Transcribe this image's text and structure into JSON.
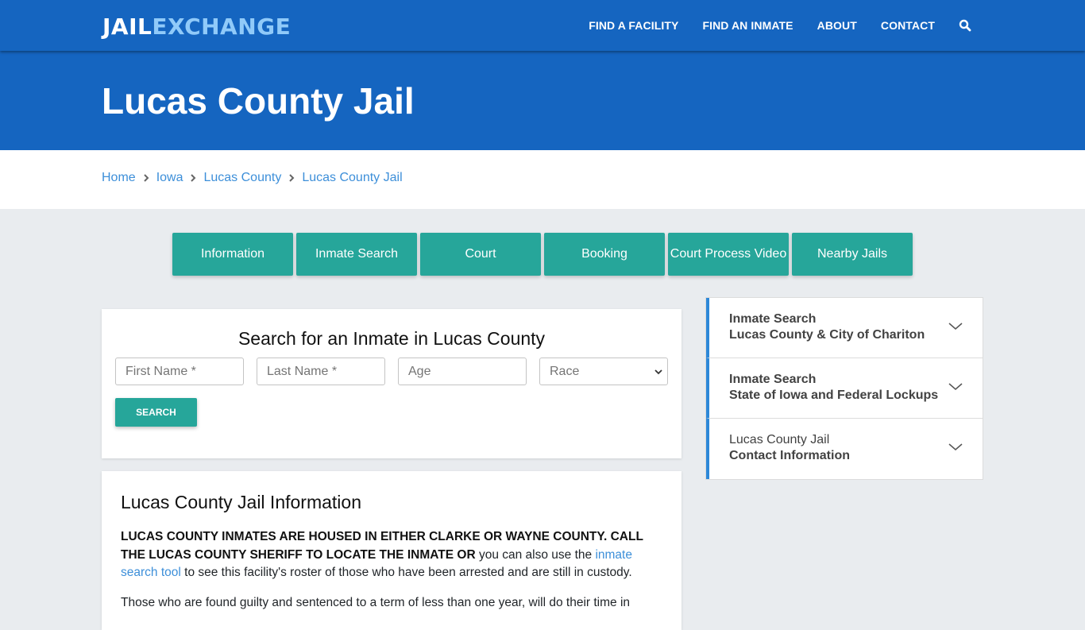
{
  "brand": {
    "part1": "JAIL",
    "part2": "EXCHANGE"
  },
  "nav": {
    "items": [
      "FIND A FACILITY",
      "FIND AN INMATE",
      "ABOUT",
      "CONTACT"
    ],
    "search_icon": "search-icon"
  },
  "hero": {
    "title": "Lucas County Jail"
  },
  "breadcrumb": [
    "Home",
    "Iowa",
    "Lucas County",
    "Lucas County Jail"
  ],
  "tabs": [
    "Information",
    "Inmate Search",
    "Court",
    "Booking",
    "Court Process Video",
    "Nearby Jails"
  ],
  "search_form": {
    "title": "Search for an Inmate in Lucas County",
    "first_name_placeholder": "First Name *",
    "last_name_placeholder": "Last Name *",
    "age_placeholder": "Age",
    "race_selected": "Race",
    "button_label": "SEARCH"
  },
  "info": {
    "title": "Lucas County Jail Information",
    "p1_bold": "LUCAS COUNTY INMATES ARE HOUSED IN EITHER CLARKE OR WAYNE COUNTY.  CALL THE LUCAS COUNTY SHERIFF TO LOCATE THE INMATE OR",
    "p1_text_before_link": " you can also use the ",
    "p1_link": "inmate search tool",
    "p1_text_after_link": " to see this facility's roster of those who have been arrested and are still in custody.",
    "p2": "Those who are found guilty and sentenced to a term of less than one year, will do their time in"
  },
  "accordion": [
    {
      "line1": "Inmate Search",
      "line2": "Lucas County & City of Chariton",
      "line1_bold": true
    },
    {
      "line1": "Inmate Search",
      "line2": "State of Iowa and Federal Lockups",
      "line1_bold": true
    },
    {
      "line1": "Lucas County Jail",
      "line2": "Contact Information",
      "line1_bold": false
    }
  ],
  "colors": {
    "brand_blue": "#1565c0",
    "logo_accent": "#90caf9",
    "teal": "#26a69a",
    "link_blue": "#3d8fd9",
    "accordion_accent": "#2d88d8"
  }
}
